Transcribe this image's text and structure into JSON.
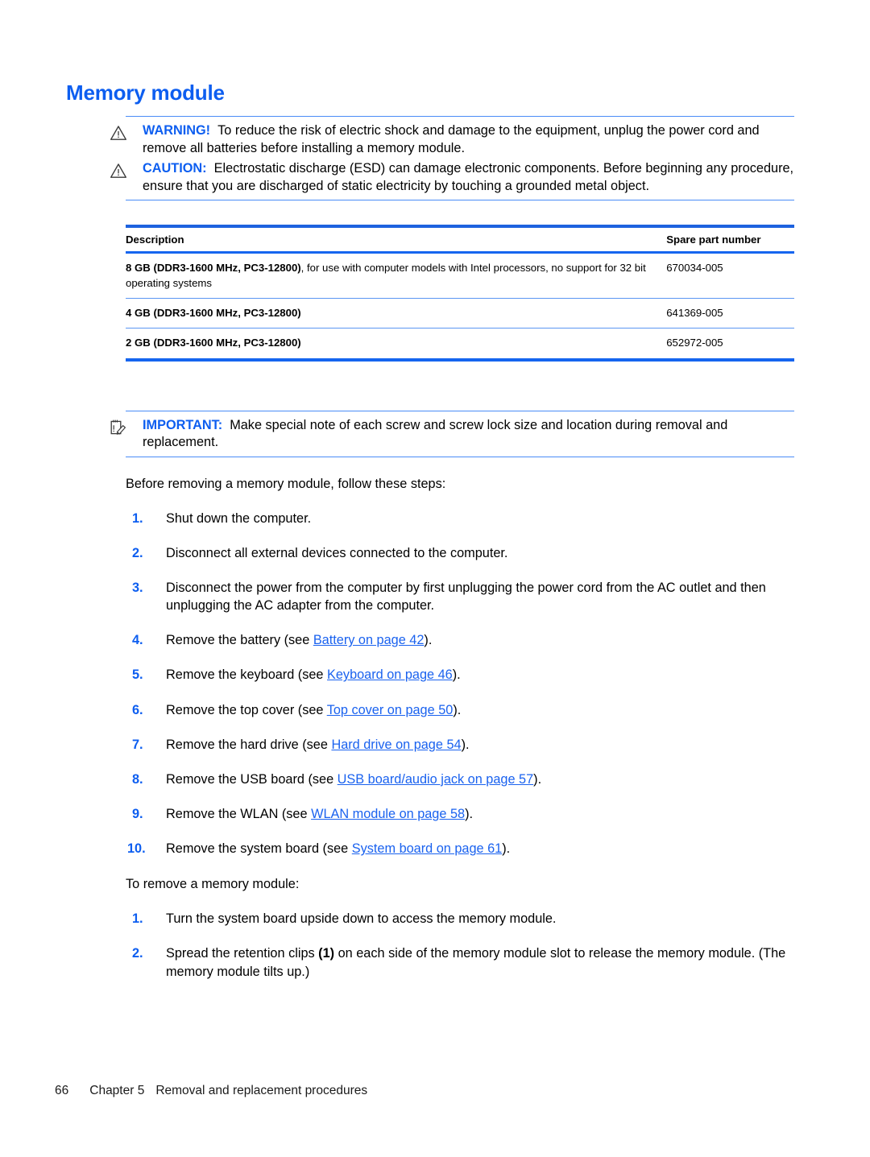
{
  "heading": "Memory module",
  "admonitions": [
    {
      "icon": "warning-triangle-icon",
      "keyword": "WARNING!",
      "text": "To reduce the risk of electric shock and damage to the equipment, unplug the power cord and remove all batteries before installing a memory module."
    },
    {
      "icon": "warning-triangle-icon",
      "keyword": "CAUTION:",
      "text": "Electrostatic discharge (ESD) can damage electronic components. Before beginning any procedure, ensure that you are discharged of static electricity by touching a grounded metal object."
    }
  ],
  "table": {
    "columns": [
      "Description",
      "Spare part number"
    ],
    "rows": [
      {
        "description_bold": "8 GB (DDR3-1600 MHz, PC3-12800)",
        "description_rest": ", for use with computer models with Intel processors, no support for 32 bit operating systems",
        "spare_part_number": "670034-005"
      },
      {
        "description_bold": "4 GB (DDR3-1600 MHz, PC3-12800)",
        "description_rest": "",
        "spare_part_number": "641369-005"
      },
      {
        "description_bold": "2 GB (DDR3-1600 MHz, PC3-12800)",
        "description_rest": "",
        "spare_part_number": "652972-005"
      }
    ]
  },
  "note": {
    "icon": "note-pencil-icon",
    "keyword": "IMPORTANT:",
    "text": "Make special note of each screw and screw lock size and location during removal and replacement."
  },
  "intro_paragraph": "Before removing a memory module, follow these steps:",
  "prep_steps": [
    {
      "num": "1.",
      "pre": "Shut down the computer.",
      "link": "",
      "post": ""
    },
    {
      "num": "2.",
      "pre": "Disconnect all external devices connected to the computer.",
      "link": "",
      "post": ""
    },
    {
      "num": "3.",
      "pre": "Disconnect the power from the computer by first unplugging the power cord from the AC outlet and then unplugging the AC adapter from the computer.",
      "link": "",
      "post": ""
    },
    {
      "num": "4.",
      "pre": "Remove the battery (see ",
      "link": "Battery on page 42",
      "post": ")."
    },
    {
      "num": "5.",
      "pre": "Remove the keyboard (see ",
      "link": "Keyboard on page 46",
      "post": ")."
    },
    {
      "num": "6.",
      "pre": "Remove the top cover (see ",
      "link": "Top cover on page 50",
      "post": ")."
    },
    {
      "num": "7.",
      "pre": "Remove the hard drive (see ",
      "link": "Hard drive on page 54",
      "post": ")."
    },
    {
      "num": "8.",
      "pre": "Remove the USB board (see ",
      "link": "USB board/audio jack on page 57",
      "post": ")."
    },
    {
      "num": "9.",
      "pre": "Remove the WLAN (see ",
      "link": "WLAN module on page 58",
      "post": ")."
    },
    {
      "num": "10.",
      "pre": "Remove the system board (see ",
      "link": "System board on page 61",
      "post": ")."
    }
  ],
  "second_paragraph": "To remove a memory module:",
  "removal_steps": [
    {
      "num": "1.",
      "pre": "Turn the system board upside down to access the memory module.",
      "bold": "",
      "post": ""
    },
    {
      "num": "2.",
      "pre": "Spread the retention clips ",
      "bold": "(1)",
      "post": " on each side of the memory module slot to release the memory module. (The memory module tilts up.)"
    }
  ],
  "footer": {
    "page_number": "66",
    "chapter": "Chapter 5",
    "chapter_title": "Removal and replacement procedures"
  },
  "colors": {
    "heading_blue": "#0d5ef0",
    "rule_blue": "#4a8cf7",
    "table_rule_blue": "#1565ef",
    "link_blue": "#1a62ef"
  }
}
